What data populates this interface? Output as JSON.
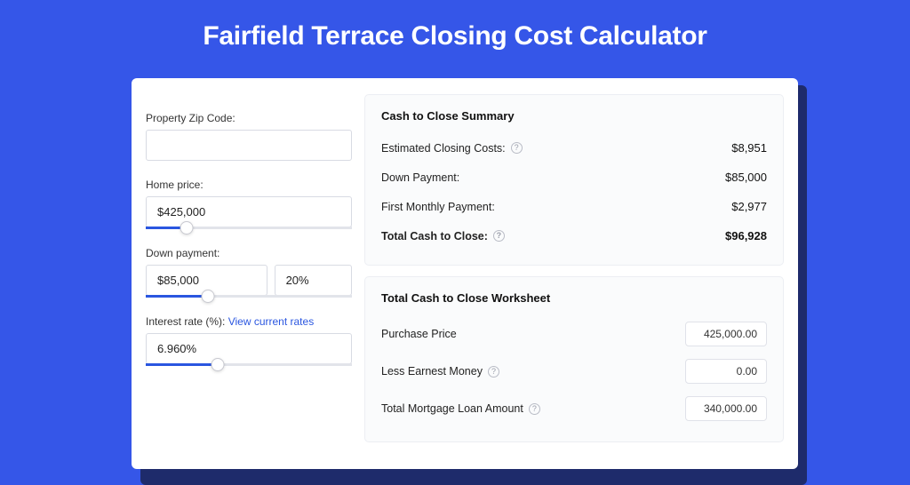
{
  "title": "Fairfield Terrace Closing Cost Calculator",
  "sidebar": {
    "zip_label": "Property Zip Code:",
    "zip_value": "",
    "home_price_label": "Home price:",
    "home_price_value": "$425,000",
    "home_price_slider_pct": 20,
    "down_payment_label": "Down payment:",
    "down_payment_value": "$85,000",
    "down_payment_pct_value": "20%",
    "down_payment_slider_pct": 30,
    "interest_label": "Interest rate (%): ",
    "interest_link": "View current rates",
    "interest_value": "6.960%",
    "interest_slider_pct": 35
  },
  "summary": {
    "title": "Cash to Close Summary",
    "rows": [
      {
        "label": "Estimated Closing Costs:",
        "help": true,
        "value": "$8,951"
      },
      {
        "label": "Down Payment:",
        "help": false,
        "value": "$85,000"
      },
      {
        "label": "First Monthly Payment:",
        "help": false,
        "value": "$2,977"
      }
    ],
    "total_label": "Total Cash to Close:",
    "total_value": "$96,928"
  },
  "worksheet": {
    "title": "Total Cash to Close Worksheet",
    "rows": [
      {
        "label": "Purchase Price",
        "help": false,
        "value": "425,000.00"
      },
      {
        "label": "Less Earnest Money",
        "help": true,
        "value": "0.00"
      },
      {
        "label": "Total Mortgage Loan Amount",
        "help": true,
        "value": "340,000.00"
      }
    ]
  }
}
